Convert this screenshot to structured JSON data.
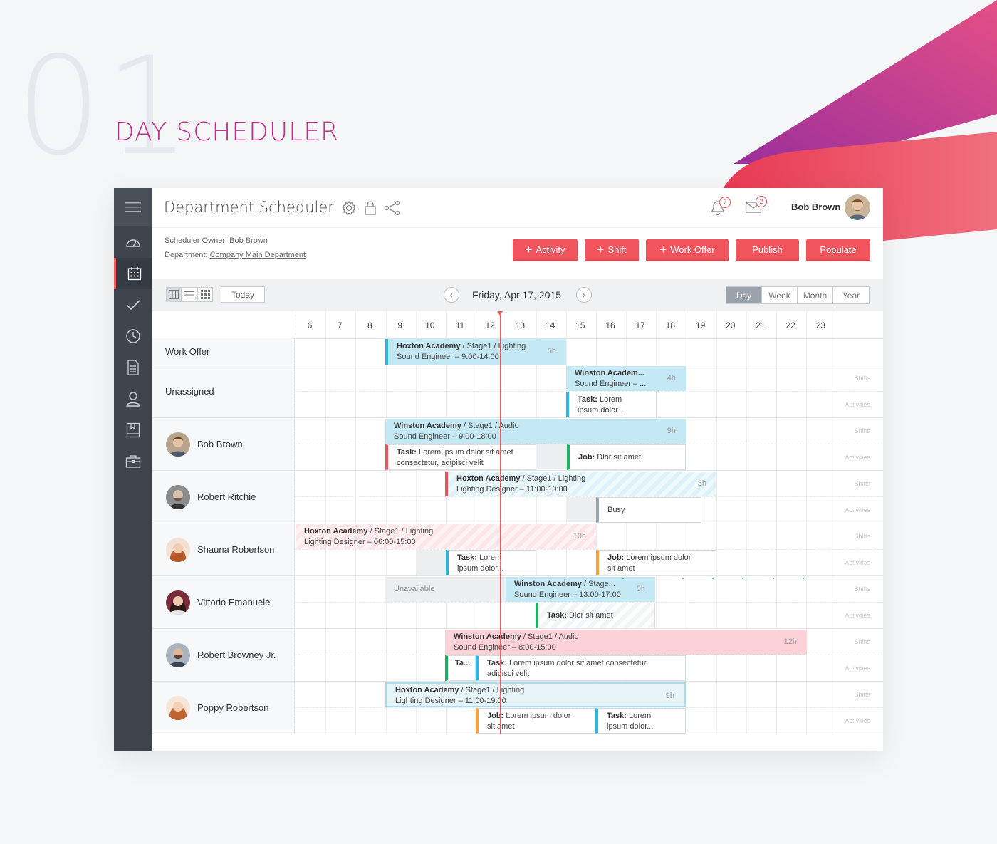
{
  "page": {
    "number": "01",
    "title": "DAY SCHEDULER"
  },
  "colors": {
    "accent": "#f0545d",
    "brand": "#c02f8a",
    "sidebar": "#3e454d",
    "shift_blue": "#c5e8f5",
    "shift_pink": "#fcd2d8",
    "task_green": "#1bb464",
    "task_orange": "#f5a13a"
  },
  "sidebar": {
    "items": [
      "menu-icon",
      "dashboard-icon",
      "calendar-icon",
      "check-icon",
      "clock-icon",
      "document-icon",
      "user-icon",
      "book-icon",
      "briefcase-icon"
    ],
    "active": "calendar-icon"
  },
  "header": {
    "title": "Department Scheduler",
    "notifications_count": "7",
    "messages_count": "2",
    "user_name": "Bob Brown"
  },
  "meta": {
    "owner_label": "Scheduler Owner:",
    "owner_value": "Bob Brown",
    "department_label": "Department:",
    "department_value": "Company Main Department"
  },
  "actions": {
    "activity": "Activity",
    "shift": "Shift",
    "work_offer": "Work Offer",
    "publish": "Publish",
    "populate": "Populate"
  },
  "toolbar": {
    "today": "Today",
    "date": "Friday, Apr 17, 2015",
    "ranges": [
      "Day",
      "Week",
      "Month",
      "Year"
    ],
    "active_range": "Day"
  },
  "hours": [
    "6",
    "7",
    "8",
    "9",
    "10",
    "11",
    "12",
    "13",
    "14",
    "15",
    "16",
    "17",
    "18",
    "19",
    "20",
    "21",
    "22",
    "23"
  ],
  "lanes": {
    "shifts": "Shifts",
    "activities": "Activities"
  },
  "rows": [
    {
      "name": "Work Offer"
    },
    {
      "name": "Unassigned"
    },
    {
      "name": "Bob Brown"
    },
    {
      "name": "Robert Ritchie"
    },
    {
      "name": "Shauna Robertson"
    },
    {
      "name": "Vittorio Emanuele"
    },
    {
      "name": "Robert Browney Jr."
    },
    {
      "name": "Poppy Robertson"
    }
  ],
  "events": {
    "wo1": {
      "place": "Hoxton Academy",
      "path": " / Stage1 / Lighting",
      "line2": "Sound Engineer – 9:00-14:00",
      "dur": "5h"
    },
    "un1": {
      "place": "Winston Academ...",
      "line2": "Sound Engineer – ...",
      "dur": "4h"
    },
    "un2": {
      "label": "Task:",
      "text": " Lorem",
      "line2": "ipsum dolor..."
    },
    "bb1": {
      "place": "Winston Academy",
      "path": " / Stage1 / Audio",
      "line2": "Sound Engineer – 9:00-18:00",
      "dur": "9h"
    },
    "bb2": {
      "label": "Task:",
      "text": " Lorem ipsum dolor sit amet",
      "line2": "consectetur, adipisci velit"
    },
    "bb3": {
      "label": "Job:",
      "text": " Dlor sit amet"
    },
    "rr1": {
      "place": "Hoxton Academy",
      "path": " / Stage1 / Lighting",
      "line2": "Lighting Designer – 11:00-19:00",
      "dur": "8h"
    },
    "rr2": {
      "text": "Busy"
    },
    "sr1": {
      "place": "Hoxton Academy",
      "path": " / Stage1 / Lighting",
      "line2": "Lighting Designer – 06:00-15:00",
      "dur": "10h"
    },
    "sr2": {
      "label": "Task:",
      "text": " Lorem",
      "line2": "ipsum dolor..."
    },
    "sr3": {
      "label": "Job:",
      "text": " Lorem ipsum dolor",
      "line2": "sit amet"
    },
    "ve0": {
      "text": "Unavailable"
    },
    "ve1": {
      "place": "Winston Academy",
      "path": " / Stage...",
      "line2": "Sound Engineer – 13:00-17:00",
      "dur": "5h"
    },
    "ve2": {
      "label": "Task:",
      "text": " Dlor sit amet"
    },
    "rb1": {
      "place": "Winston Academy",
      "path": " / Stage1 / Audio",
      "line2": "Sound Engineer – 8:00-15:00",
      "dur": "12h"
    },
    "rb2": {
      "label": "Ta..."
    },
    "rb3": {
      "label": "Task:",
      "text": " Lorem ipsum dolor sit amet consectetur,",
      "line2": "adipisci velit"
    },
    "pr1": {
      "place": "Hoxton Academy",
      "path": " / Stage1 / Lighting",
      "line2": "Lighting Designer – 11:00-19:00",
      "dur": "9h"
    },
    "pr2": {
      "label": "Job:",
      "text": " Lorem ipsum dolor",
      "line2": "sit amet"
    },
    "pr3": {
      "label": "Task:",
      "text": " Lorem",
      "line2": "ipsum dolor..."
    }
  }
}
